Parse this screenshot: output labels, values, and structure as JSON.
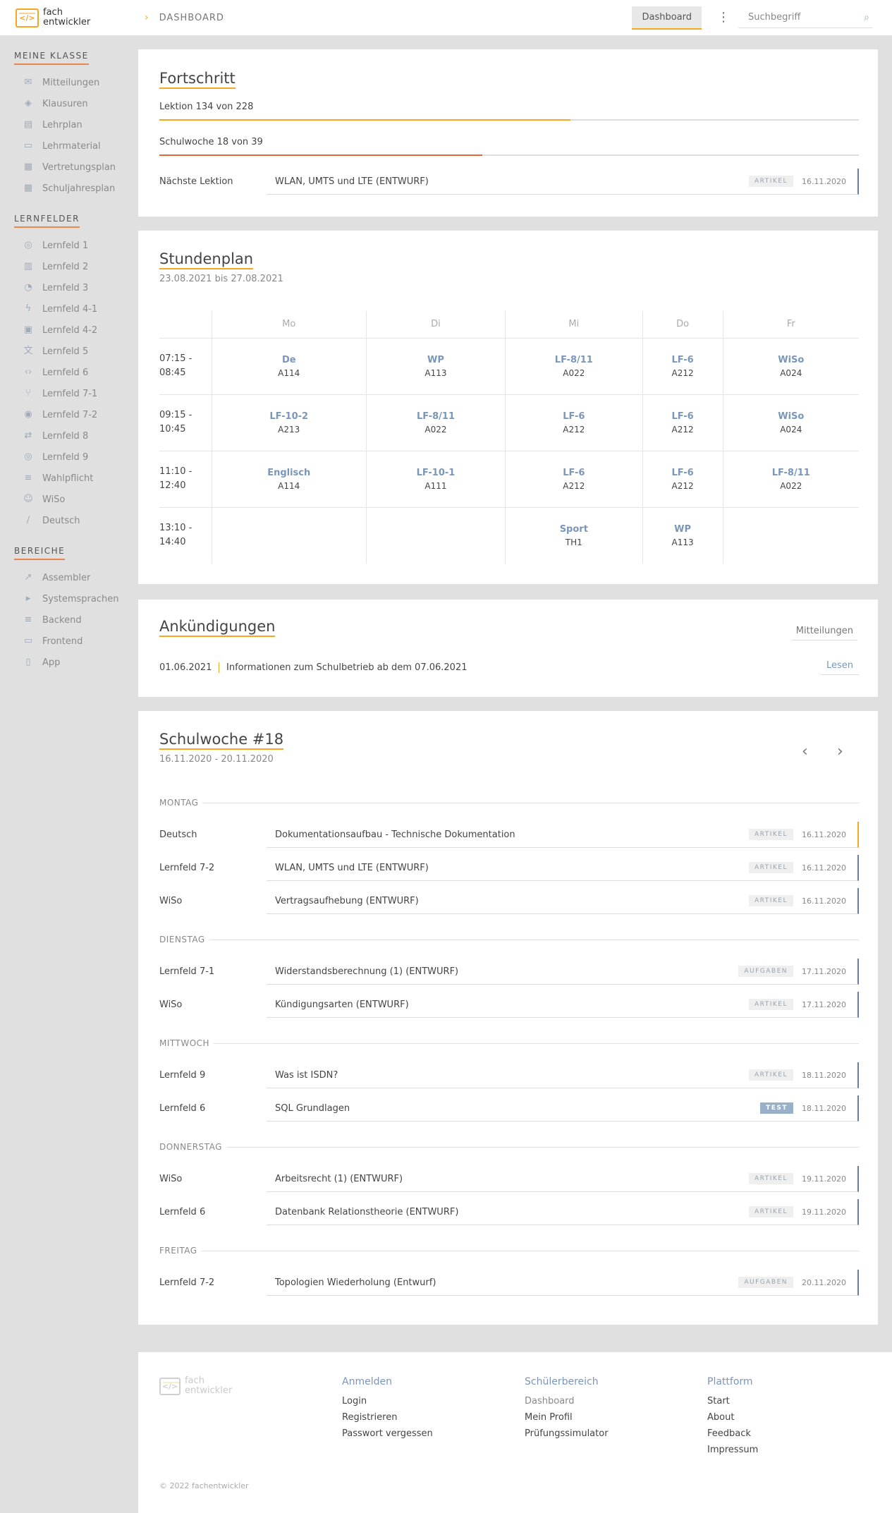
{
  "header": {
    "logo_line1": "fach",
    "logo_line2": "entwickler",
    "logo_glyph": "</>",
    "breadcrumb": "DASHBOARD",
    "dashboard_button": "Dashboard",
    "search_placeholder": "Suchbegriff"
  },
  "sidebar": {
    "sections": [
      {
        "title": "MEINE KLASSE",
        "items": [
          {
            "label": "Mitteilungen",
            "icon": "mail-icon"
          },
          {
            "label": "Klausuren",
            "icon": "layers-icon"
          },
          {
            "label": "Lehrplan",
            "icon": "book-icon"
          },
          {
            "label": "Lehrmaterial",
            "icon": "folder-icon"
          },
          {
            "label": "Vertretungsplan",
            "icon": "calendar-icon"
          },
          {
            "label": "Schuljahresplan",
            "icon": "calendar-grid-icon"
          }
        ]
      },
      {
        "title": "LERNFELDER",
        "items": [
          {
            "label": "Lernfeld 1",
            "icon": "globe-icon"
          },
          {
            "label": "Lernfeld 2",
            "icon": "building-icon"
          },
          {
            "label": "Lernfeld 3",
            "icon": "pie-chart-icon"
          },
          {
            "label": "Lernfeld 4-1",
            "icon": "bolt-icon"
          },
          {
            "label": "Lernfeld 4-2",
            "icon": "chip-icon"
          },
          {
            "label": "Lernfeld 5",
            "icon": "translate-icon"
          },
          {
            "label": "Lernfeld 6",
            "icon": "code-icon"
          },
          {
            "label": "Lernfeld 7-1",
            "icon": "branch-icon"
          },
          {
            "label": "Lernfeld 7-2",
            "icon": "broadcast-icon"
          },
          {
            "label": "Lernfeld 8",
            "icon": "swap-icon"
          },
          {
            "label": "Lernfeld 9",
            "icon": "globe-icon"
          },
          {
            "label": "Wahlpflicht",
            "icon": "database-icon"
          },
          {
            "label": "WiSo",
            "icon": "person-icon"
          },
          {
            "label": "Deutsch",
            "icon": "pen-icon"
          }
        ]
      },
      {
        "title": "BEREICHE",
        "items": [
          {
            "label": "Assembler",
            "icon": "rocket-icon"
          },
          {
            "label": "Systemsprachen",
            "icon": "terminal-icon"
          },
          {
            "label": "Backend",
            "icon": "database-icon"
          },
          {
            "label": "Frontend",
            "icon": "monitor-icon"
          },
          {
            "label": "App",
            "icon": "phone-icon"
          }
        ]
      }
    ]
  },
  "progress": {
    "title": "Fortschritt",
    "lesson_label": "Lektion 134 von 228",
    "lesson_fraction": 0.5877,
    "week_label": "Schulwoche 18 von 39",
    "week_fraction": 0.4615,
    "next_label": "Nächste Lektion",
    "next_title": "WLAN, UMTS und LTE (ENTWURF)",
    "next_badge": "ARTIKEL",
    "next_date": "16.11.2020",
    "colors": {
      "lesson": "#f5a623",
      "week": "#e8663a",
      "accent": "#f5a623"
    }
  },
  "timetable": {
    "title": "Stundenplan",
    "range": "23.08.2021 bis 27.08.2021",
    "days": [
      "Mo",
      "Di",
      "Mi",
      "Do",
      "Fr"
    ],
    "rows": [
      {
        "time1": "07:15 -",
        "time2": "08:45",
        "cells": [
          {
            "s": "De",
            "r": "A114"
          },
          {
            "s": "WP",
            "r": "A113"
          },
          {
            "s": "LF-8/11",
            "r": "A022"
          },
          {
            "s": "LF-6",
            "r": "A212"
          },
          {
            "s": "WiSo",
            "r": "A024"
          }
        ]
      },
      {
        "time1": "09:15 -",
        "time2": "10:45",
        "cells": [
          {
            "s": "LF-10-2",
            "r": "A213"
          },
          {
            "s": "LF-8/11",
            "r": "A022"
          },
          {
            "s": "LF-6",
            "r": "A212"
          },
          {
            "s": "LF-6",
            "r": "A212"
          },
          {
            "s": "WiSo",
            "r": "A024"
          }
        ]
      },
      {
        "time1": "11:10 -",
        "time2": "12:40",
        "cells": [
          {
            "s": "Englisch",
            "r": "A114"
          },
          {
            "s": "LF-10-1",
            "r": "A111"
          },
          {
            "s": "LF-6",
            "r": "A212"
          },
          {
            "s": "LF-6",
            "r": "A212"
          },
          {
            "s": "LF-8/11",
            "r": "A022"
          }
        ]
      },
      {
        "time1": "13:10 -",
        "time2": "14:40",
        "cells": [
          {
            "s": "",
            "r": ""
          },
          {
            "s": "",
            "r": ""
          },
          {
            "s": "Sport",
            "r": "TH1"
          },
          {
            "s": "WP",
            "r": "A113"
          },
          {
            "s": "",
            "r": ""
          }
        ]
      }
    ]
  },
  "announcements": {
    "title": "Ankündigungen",
    "button": "Mitteilungen",
    "items": [
      {
        "date": "01.06.2021",
        "text": "Informationen zum Schulbetrieb ab dem 07.06.2021",
        "action": "Lesen"
      }
    ]
  },
  "week": {
    "title": "Schulwoche #18",
    "range": "16.11.2020 - 20.11.2020",
    "prev_icon": "chevron-left-icon",
    "next_icon": "chevron-right-icon",
    "days": [
      {
        "name": "MONTAG",
        "lessons": [
          {
            "field": "Deutsch",
            "title": "Dokumentationsaufbau - Technische Dokumentation",
            "badge": "ARTIKEL",
            "date": "16.11.2020",
            "accent": "#f5a623"
          },
          {
            "field": "Lernfeld 7-2",
            "title": "WLAN, UMTS und LTE (ENTWURF)",
            "badge": "ARTIKEL",
            "date": "16.11.2020",
            "accent": "#6a7e9a"
          },
          {
            "field": "WiSo",
            "title": "Vertragsaufhebung (ENTWURF)",
            "badge": "ARTIKEL",
            "date": "16.11.2020",
            "accent": "#6a7e9a"
          }
        ]
      },
      {
        "name": "DIENSTAG",
        "lessons": [
          {
            "field": "Lernfeld 7-1",
            "title": "Widerstandsberechnung (1) (ENTWURF)",
            "badge": "AUFGABEN",
            "date": "17.11.2020",
            "accent": "#6a7e9a"
          },
          {
            "field": "WiSo",
            "title": "Kündigungsarten (ENTWURF)",
            "badge": "ARTIKEL",
            "date": "17.11.2020",
            "accent": "#6a7e9a"
          }
        ]
      },
      {
        "name": "MITTWOCH",
        "lessons": [
          {
            "field": "Lernfeld 9",
            "title": "Was ist ISDN?",
            "badge": "ARTIKEL",
            "date": "18.11.2020",
            "accent": "#6a7e9a"
          },
          {
            "field": "Lernfeld 6",
            "title": "SQL Grundlagen",
            "badge": "TEST",
            "date": "18.11.2020",
            "accent": "#6a7e9a"
          }
        ]
      },
      {
        "name": "DONNERSTAG",
        "lessons": [
          {
            "field": "WiSo",
            "title": "Arbeitsrecht (1) (ENTWURF)",
            "badge": "ARTIKEL",
            "date": "19.11.2020",
            "accent": "#6a7e9a"
          },
          {
            "field": "Lernfeld 6",
            "title": "Datenbank Relationstheorie (ENTWURF)",
            "badge": "ARTIKEL",
            "date": "19.11.2020",
            "accent": "#6a7e9a"
          }
        ]
      },
      {
        "name": "FREITAG",
        "lessons": [
          {
            "field": "Lernfeld 7-2",
            "title": "Topologien Wiederholung (Entwurf)",
            "badge": "AUFGABEN",
            "date": "20.11.2020",
            "accent": "#6a7e9a"
          }
        ]
      }
    ]
  },
  "footer": {
    "logo_line1": "fach",
    "logo_line2": "entwickler",
    "columns": [
      {
        "title": "Anmelden",
        "links": [
          "Login",
          "Registrieren",
          "Passwort vergessen"
        ]
      },
      {
        "title": "Schülerbereich",
        "links": [
          "Dashboard",
          "Mein Profil",
          "Prüfungssimulator"
        ]
      },
      {
        "title": "Plattform",
        "links": [
          "Start",
          "About",
          "Feedback",
          "Impressum"
        ]
      }
    ],
    "copyright": "© 2022 fachentwickler"
  }
}
